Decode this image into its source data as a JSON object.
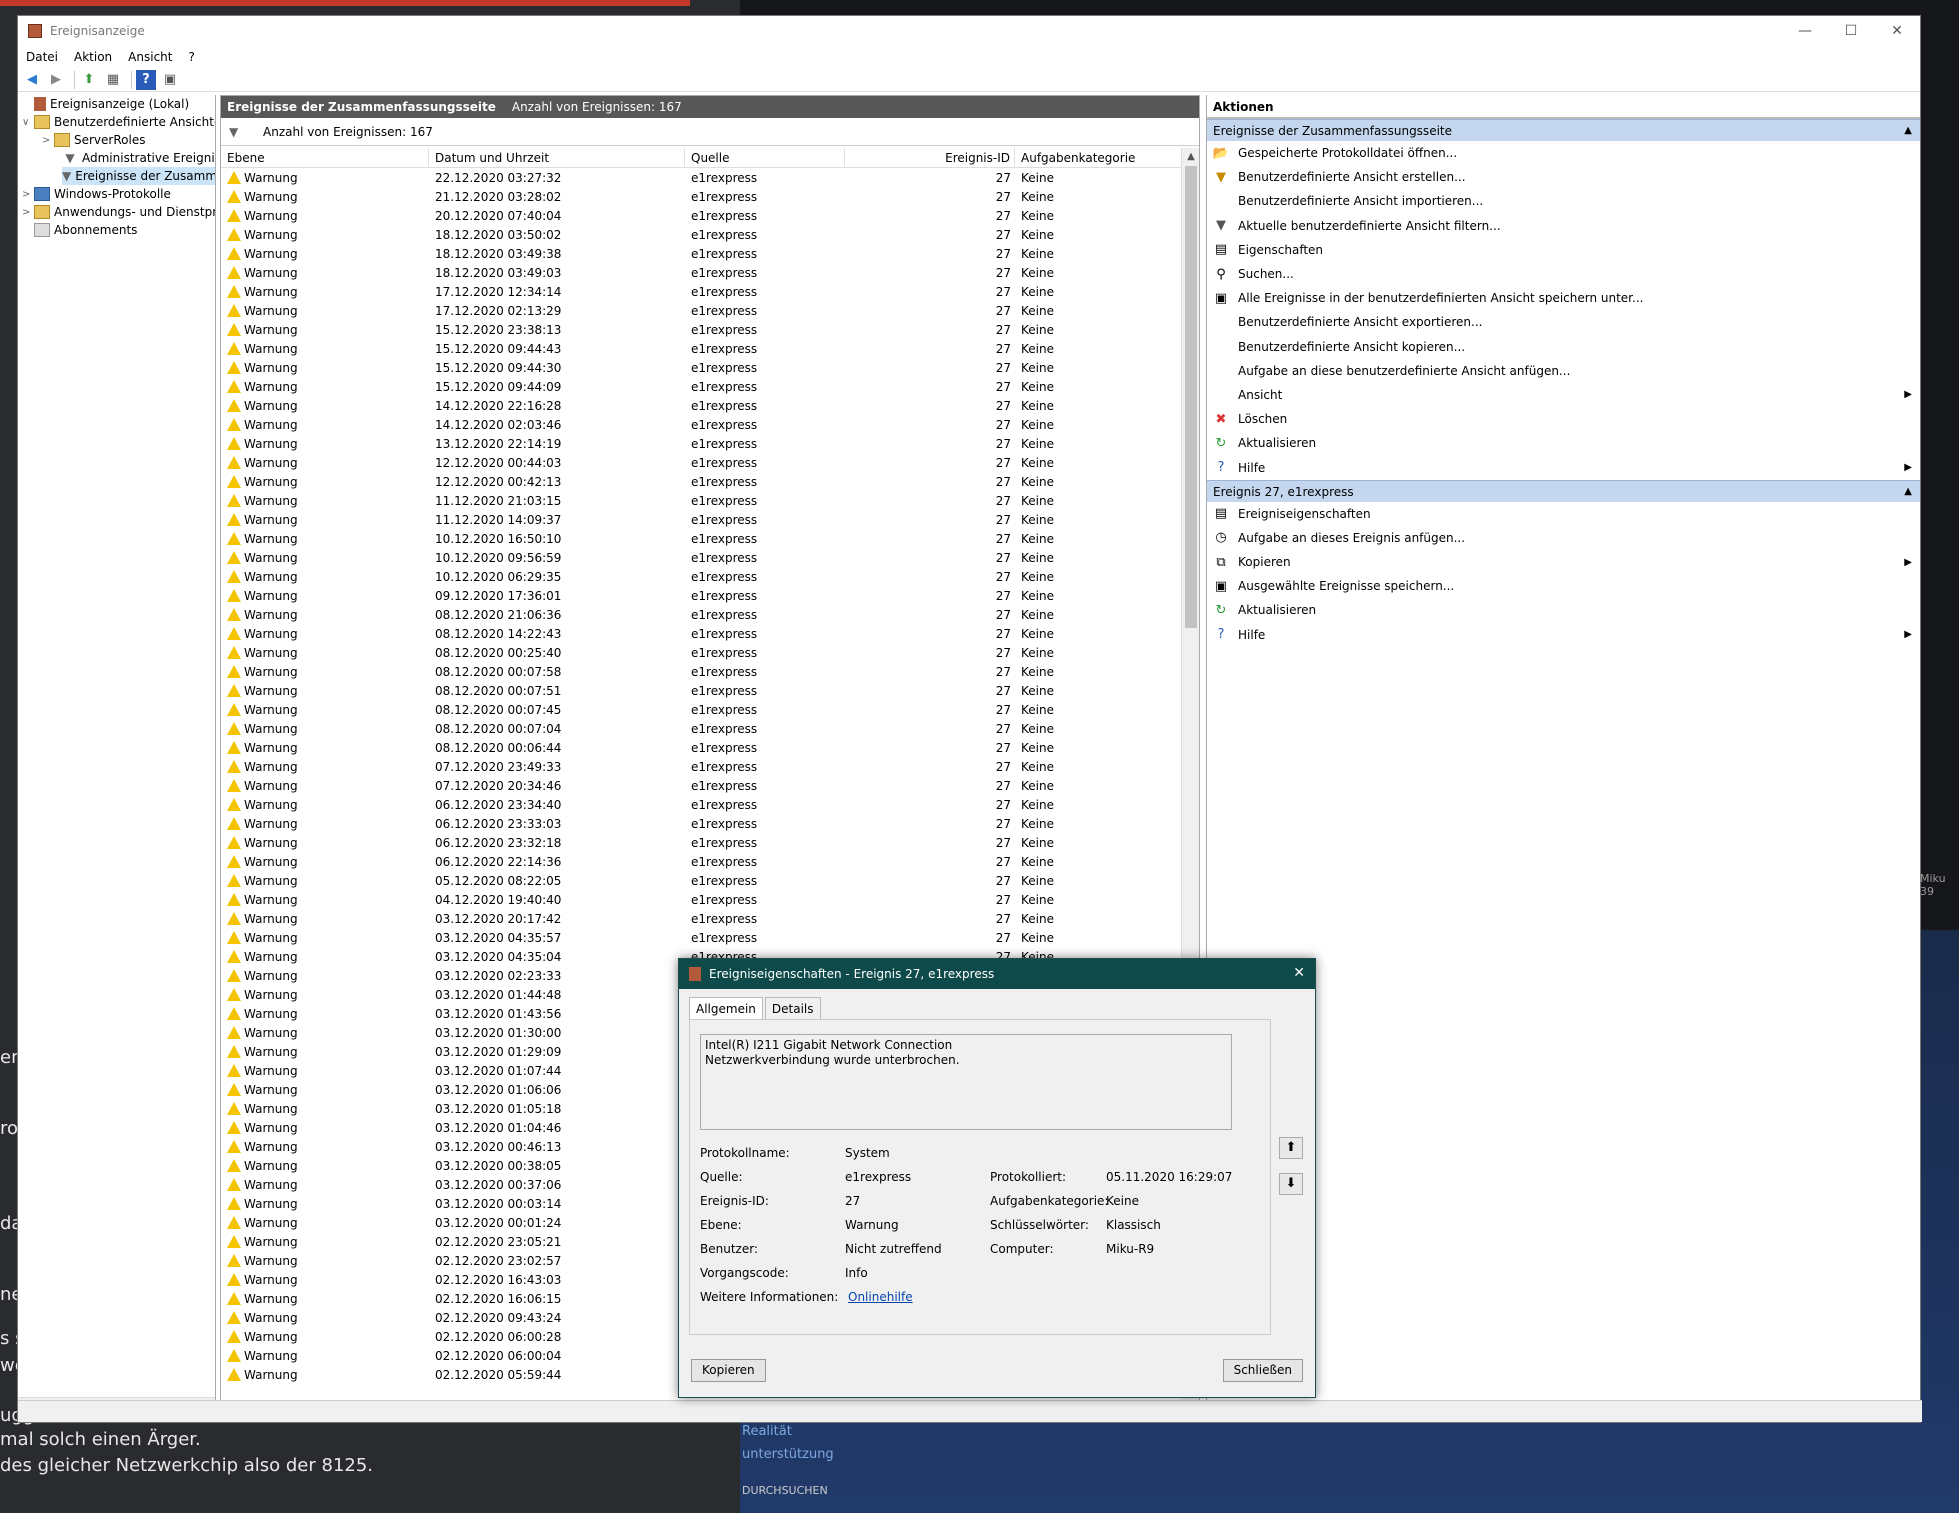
{
  "background": {
    "left_texts": [
      "em",
      "ro",
      "da",
      "ner",
      "s s",
      "we",
      "ugg",
      "mal solch einen Ärger.",
      "des gleicher Netzwerkchip also der 8125."
    ],
    "right_texts": [
      "Realität",
      "unterstützung",
      "DURCHSUCHEN"
    ],
    "mini": "Miku 39"
  },
  "window": {
    "title": "Ereignisanzeige",
    "menu": [
      "Datei",
      "Aktion",
      "Ansicht",
      "?"
    ]
  },
  "tree": {
    "items": [
      {
        "label": "Ereignisanzeige (Lokal)",
        "toggle": ""
      },
      {
        "label": "Benutzerdefinierte Ansichten",
        "toggle": "∨"
      },
      {
        "label": "ServerRoles",
        "toggle": ">"
      },
      {
        "label": "Administrative Ereignisse",
        "toggle": ""
      },
      {
        "label": "Ereignisse der Zusammenfassungsseite",
        "toggle": ""
      },
      {
        "label": "Windows-Protokolle",
        "toggle": ">"
      },
      {
        "label": "Anwendungs- und Dienstprotokolle",
        "toggle": ">"
      },
      {
        "label": "Abonnements",
        "toggle": ""
      }
    ]
  },
  "middle": {
    "header_title": "Ereignisse der Zusammenfassungsseite",
    "header_count": "Anzahl von Ereignissen: 167",
    "filter_text": "Anzahl von Ereignissen: 167",
    "columns": [
      "Ebene",
      "Datum und Uhrzeit",
      "Quelle",
      "Ereignis-ID",
      "Aufgabenkategorie"
    ],
    "level": "Warnung",
    "source": "e1rexpress",
    "event_id": "27",
    "category": "Keine",
    "dates": [
      "22.12.2020 03:27:32",
      "21.12.2020 03:28:02",
      "20.12.2020 07:40:04",
      "18.12.2020 03:50:02",
      "18.12.2020 03:49:38",
      "18.12.2020 03:49:03",
      "17.12.2020 12:34:14",
      "17.12.2020 02:13:29",
      "15.12.2020 23:38:13",
      "15.12.2020 09:44:43",
      "15.12.2020 09:44:30",
      "15.12.2020 09:44:09",
      "14.12.2020 22:16:28",
      "14.12.2020 02:03:46",
      "13.12.2020 22:14:19",
      "12.12.2020 00:44:03",
      "12.12.2020 00:42:13",
      "11.12.2020 21:03:15",
      "11.12.2020 14:09:37",
      "10.12.2020 16:50:10",
      "10.12.2020 09:56:59",
      "10.12.2020 06:29:35",
      "09.12.2020 17:36:01",
      "08.12.2020 21:06:36",
      "08.12.2020 14:22:43",
      "08.12.2020 00:25:40",
      "08.12.2020 00:07:58",
      "08.12.2020 00:07:51",
      "08.12.2020 00:07:45",
      "08.12.2020 00:07:04",
      "08.12.2020 00:06:44",
      "07.12.2020 23:49:33",
      "07.12.2020 20:34:46",
      "06.12.2020 23:34:40",
      "06.12.2020 23:33:03",
      "06.12.2020 23:32:18",
      "06.12.2020 22:14:36",
      "05.12.2020 08:22:05",
      "04.12.2020 19:40:40",
      "03.12.2020 20:17:42",
      "03.12.2020 04:35:57",
      "03.12.2020 04:35:04",
      "03.12.2020 02:23:33",
      "03.12.2020 01:44:48",
      "03.12.2020 01:43:56",
      "03.12.2020 01:30:00",
      "03.12.2020 01:29:09",
      "03.12.2020 01:07:44",
      "03.12.2020 01:06:06",
      "03.12.2020 01:05:18",
      "03.12.2020 01:04:46",
      "03.12.2020 00:46:13",
      "03.12.2020 00:38:05",
      "03.12.2020 00:37:06",
      "03.12.2020 00:03:14",
      "03.12.2020 00:01:24",
      "02.12.2020 23:05:21",
      "02.12.2020 23:02:57",
      "02.12.2020 16:43:03",
      "02.12.2020 16:06:15",
      "02.12.2020 09:43:24",
      "02.12.2020 06:00:28",
      "02.12.2020 06:00:04",
      "02.12.2020 05:59:44"
    ]
  },
  "actions": {
    "title": "Aktionen",
    "section1": "Ereignisse der Zusammenfassungsseite",
    "items1": [
      {
        "label": "Gespeicherte Protokolldatei öffnen...",
        "icon": "open-folder-icon",
        "glyph": "📂",
        "arrow": false
      },
      {
        "label": "Benutzerdefinierte Ansicht erstellen...",
        "icon": "funnel-star-icon",
        "glyph": "▼",
        "arrow": false
      },
      {
        "label": "Benutzerdefinierte Ansicht importieren...",
        "icon": "",
        "glyph": "",
        "arrow": false
      },
      {
        "label": "Aktuelle benutzerdefinierte Ansicht filtern...",
        "icon": "filter-icon",
        "glyph": "▼",
        "arrow": false
      },
      {
        "label": "Eigenschaften",
        "icon": "properties-icon",
        "glyph": "▤",
        "arrow": false
      },
      {
        "label": "Suchen...",
        "icon": "binoculars-icon",
        "glyph": "⚲",
        "arrow": false
      },
      {
        "label": "Alle Ereignisse in der benutzerdefinierten Ansicht speichern unter...",
        "icon": "save-icon",
        "glyph": "▣",
        "arrow": false
      },
      {
        "label": "Benutzerdefinierte Ansicht exportieren...",
        "icon": "",
        "glyph": "",
        "arrow": false
      },
      {
        "label": "Benutzerdefinierte Ansicht kopieren...",
        "icon": "",
        "glyph": "",
        "arrow": false
      },
      {
        "label": "Aufgabe an diese benutzerdefinierte Ansicht anfügen...",
        "icon": "",
        "glyph": "",
        "arrow": false
      },
      {
        "label": "Ansicht",
        "icon": "",
        "glyph": "",
        "arrow": true
      },
      {
        "label": "Löschen",
        "icon": "delete-icon",
        "glyph": "✖",
        "arrow": false
      },
      {
        "label": "Aktualisieren",
        "icon": "refresh-icon",
        "glyph": "↻",
        "arrow": false
      },
      {
        "label": "Hilfe",
        "icon": "help-icon",
        "glyph": "?",
        "arrow": true
      }
    ],
    "section2": "Ereignis 27, e1rexpress",
    "items2": [
      {
        "label": "Ereigniseigenschaften",
        "icon": "properties-icon",
        "glyph": "▤",
        "arrow": false
      },
      {
        "label": "Aufgabe an dieses Ereignis anfügen...",
        "icon": "task-icon",
        "glyph": "◷",
        "arrow": false
      },
      {
        "label": "Kopieren",
        "icon": "copy-icon",
        "glyph": "⧉",
        "arrow": true
      },
      {
        "label": "Ausgewählte Ereignisse speichern...",
        "icon": "save-icon",
        "glyph": "▣",
        "arrow": false
      },
      {
        "label": "Aktualisieren",
        "icon": "refresh-icon",
        "glyph": "↻",
        "arrow": false
      },
      {
        "label": "Hilfe",
        "icon": "help-icon",
        "glyph": "?",
        "arrow": true
      }
    ]
  },
  "dialog": {
    "title": "Ereigniseigenschaften - Ereignis 27, e1rexpress",
    "tabs": [
      "Allgemein",
      "Details"
    ],
    "description_line1": "Intel(R) I211 Gigabit Network Connection",
    "description_line2": "Netzwerkverbindung wurde unterbrochen.",
    "props": {
      "protokollname_label": "Protokollname:",
      "protokollname": "System",
      "quelle_label": "Quelle:",
      "quelle": "e1rexpress",
      "protokolliert_label": "Protokolliert:",
      "protokolliert": "05.11.2020 16:29:07",
      "ereignis_id_label": "Ereignis-ID:",
      "ereignis_id": "27",
      "aufgabenkategorie_label": "Aufgabenkategorie:",
      "aufgabenkategorie": "Keine",
      "ebene_label": "Ebene:",
      "ebene": "Warnung",
      "schluesselwoerter_label": "Schlüsselwörter:",
      "schluesselwoerter": "Klassisch",
      "benutzer_label": "Benutzer:",
      "benutzer": "Nicht zutreffend",
      "computer_label": "Computer:",
      "computer": "Miku-R9",
      "vorgangscode_label": "Vorgangscode:",
      "vorgangscode": "Info",
      "weitere_label": "Weitere Informationen:",
      "weitere_link": "Onlinehilfe"
    },
    "copy_button": "Kopieren",
    "close_button": "Schließen"
  }
}
